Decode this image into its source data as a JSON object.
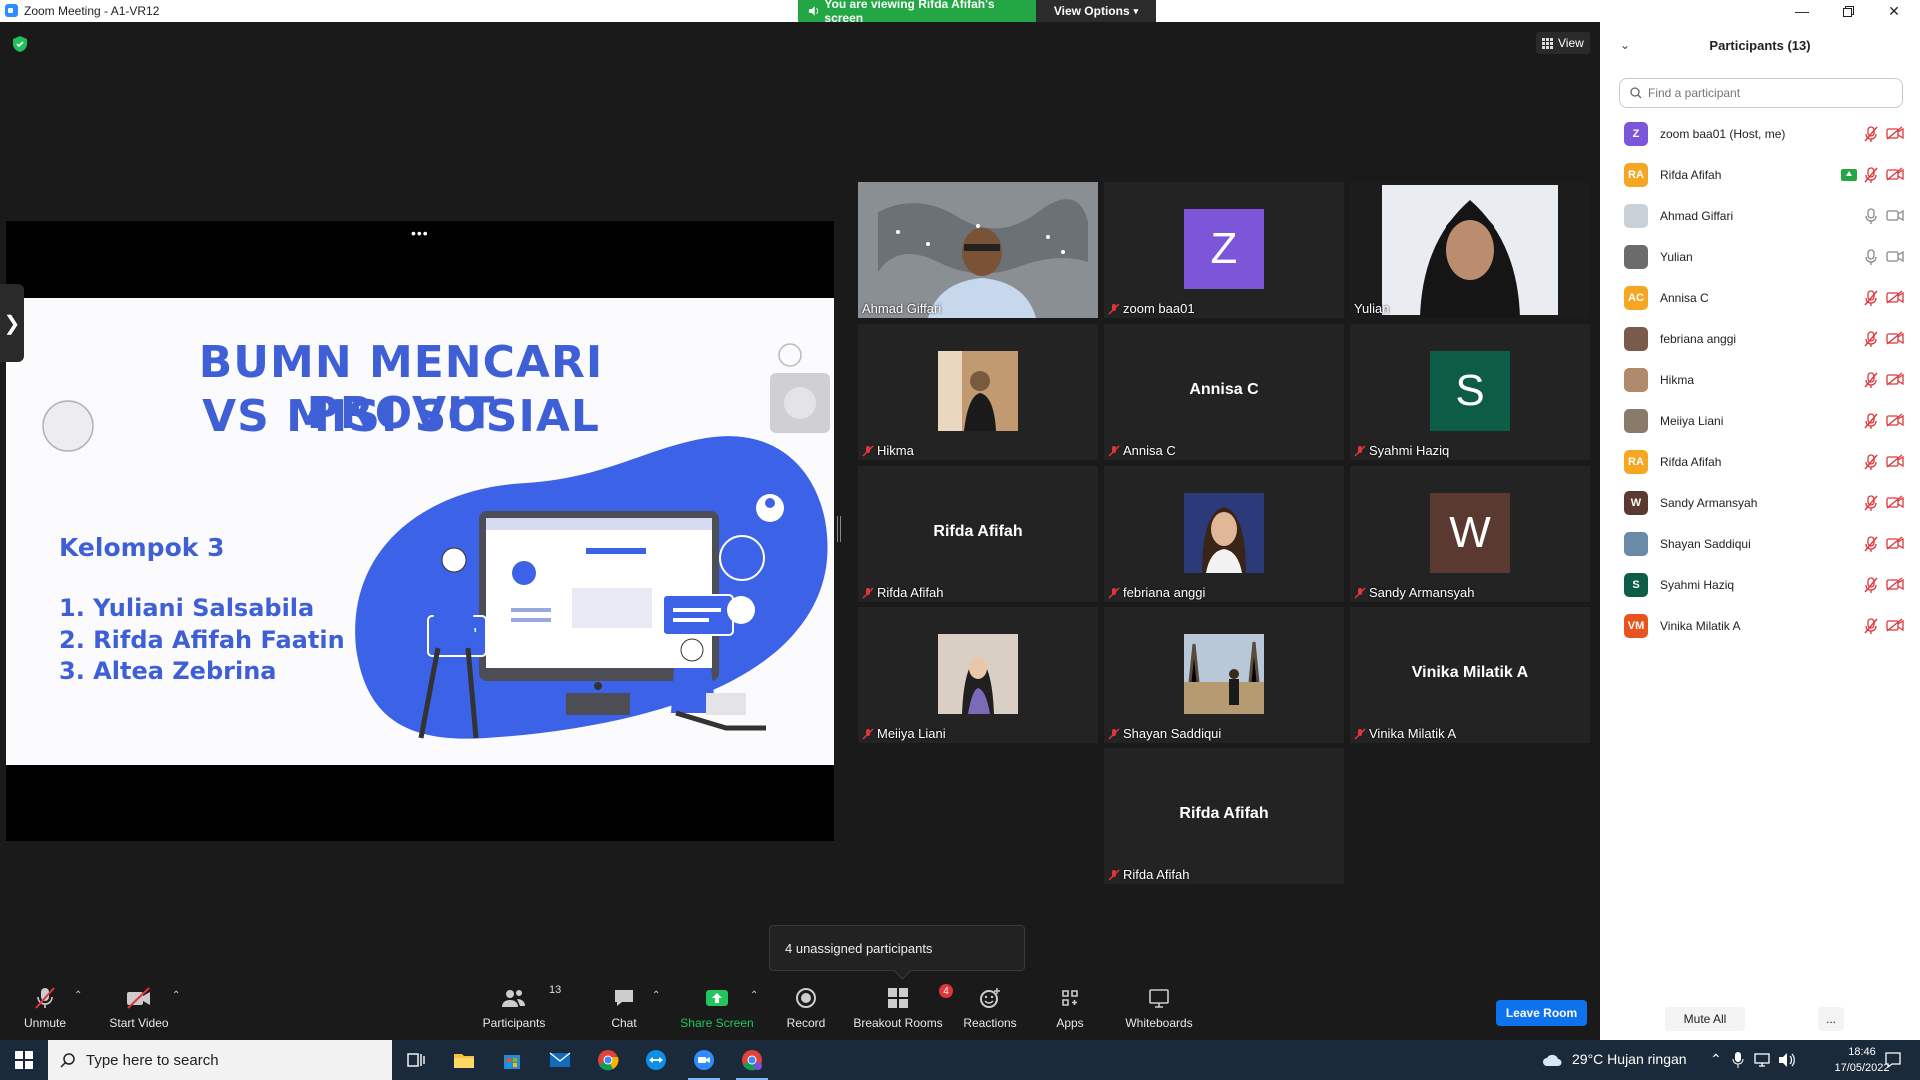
{
  "window": {
    "title": "Zoom Meeting - A1-VR12",
    "controls": [
      "minimize",
      "restore",
      "close"
    ]
  },
  "banner": {
    "viewing_text": "You are viewing Rifda Afifah's screen",
    "view_options_label": "View Options"
  },
  "view_button_label": "View",
  "slide": {
    "title_line1": "BUMN MENCARI PROVIT",
    "title_line2": "VS MISI SOSIAL",
    "group": "Kelompok 3",
    "members": [
      "1. Yuliani Salsabila",
      "2. Rifda Afifah Faatin",
      "3. Altea Zebrina"
    ],
    "colors": {
      "brand": "#3f5fd6",
      "blob": "#3c62e8"
    }
  },
  "gallery": [
    {
      "name": "Ahmad Giffari",
      "type": "video",
      "muted": false
    },
    {
      "name": "zoom baa01",
      "type": "avatar",
      "initial": "Z",
      "avatar_color": "#7d55d9",
      "muted": true
    },
    {
      "name": "Yulian",
      "type": "video",
      "muted": false,
      "active_speaker": true
    },
    {
      "name": "Hikma",
      "type": "photo",
      "muted": true
    },
    {
      "name": "Annisa C",
      "type": "text",
      "muted": true
    },
    {
      "name": "Syahmi Haziq",
      "type": "avatar",
      "initial": "S",
      "avatar_color": "#0d5c45",
      "muted": true
    },
    {
      "name": "Rifda Afifah",
      "type": "text",
      "muted": true
    },
    {
      "name": "febriana anggi",
      "type": "photo",
      "muted": true
    },
    {
      "name": "Sandy Armansyah",
      "type": "avatar",
      "initial": "W",
      "avatar_color": "#5a3a30",
      "muted": true
    },
    {
      "name": "Meiiya Liani",
      "type": "photo",
      "muted": true
    },
    {
      "name": "Shayan Saddiqui",
      "type": "photo",
      "muted": true
    },
    {
      "name": "Vinika Milatik A",
      "type": "text",
      "muted": true
    },
    {
      "name": "Rifda Afifah",
      "type": "text",
      "muted": true
    }
  ],
  "tooltip": "4 unassigned participants",
  "toolbar": {
    "unmute": "Unmute",
    "start_video": "Start Video",
    "participants": "Participants",
    "participants_count": "13",
    "chat": "Chat",
    "share_screen": "Share Screen",
    "record": "Record",
    "breakout_rooms": "Breakout Rooms",
    "breakout_badge": "4",
    "reactions": "Reactions",
    "apps": "Apps",
    "whiteboards": "Whiteboards",
    "leave_room": "Leave Room"
  },
  "panel": {
    "title": "Participants (13)",
    "search_placeholder": "Find a participant",
    "participants": [
      {
        "name": "zoom baa01 (Host, me)",
        "initials": "Z",
        "color": "#7d55d9",
        "mic": "muted",
        "cam": "off"
      },
      {
        "name": "Rifda Afifah",
        "initials": "RA",
        "color": "#f5a623",
        "mic": "muted",
        "cam": "off",
        "sharing": true
      },
      {
        "name": "Ahmad Giffari",
        "initials": "",
        "color": "#c8d0d8",
        "mic": "on",
        "cam": "on"
      },
      {
        "name": "Yulian",
        "initials": "",
        "color": "#6b6b6b",
        "mic": "on",
        "cam": "on"
      },
      {
        "name": "Annisa C",
        "initials": "AC",
        "color": "#f5a623",
        "mic": "muted",
        "cam": "off"
      },
      {
        "name": "febriana anggi",
        "initials": "",
        "color": "#7a5a4a",
        "mic": "muted",
        "cam": "off"
      },
      {
        "name": "Hikma",
        "initials": "",
        "color": "#b08a6a",
        "mic": "muted",
        "cam": "off"
      },
      {
        "name": "Meiiya Liani",
        "initials": "",
        "color": "#8a7a6a",
        "mic": "muted",
        "cam": "off"
      },
      {
        "name": "Rifda Afifah",
        "initials": "RA",
        "color": "#f5a623",
        "mic": "muted",
        "cam": "off"
      },
      {
        "name": "Sandy Armansyah",
        "initials": "W",
        "color": "#5a3a30",
        "mic": "muted",
        "cam": "off"
      },
      {
        "name": "Shayan Saddiqui",
        "initials": "",
        "color": "#6a8aa8",
        "mic": "muted",
        "cam": "off"
      },
      {
        "name": "Syahmi Haziq",
        "initials": "S",
        "color": "#0d5c45",
        "mic": "muted",
        "cam": "off"
      },
      {
        "name": "Vinika Milatik A",
        "initials": "VM",
        "color": "#e8541e",
        "mic": "muted",
        "cam": "off"
      }
    ],
    "mute_all": "Mute All",
    "more": "..."
  },
  "taskbar": {
    "search_placeholder": "Type here to search",
    "weather": "29°C  Hujan ringan",
    "time": "18:46",
    "date": "17/05/2022",
    "apps": [
      "task-view",
      "file-explorer",
      "microsoft-store",
      "mail",
      "chrome",
      "teamviewer",
      "zoom",
      "chrome-profile"
    ]
  }
}
